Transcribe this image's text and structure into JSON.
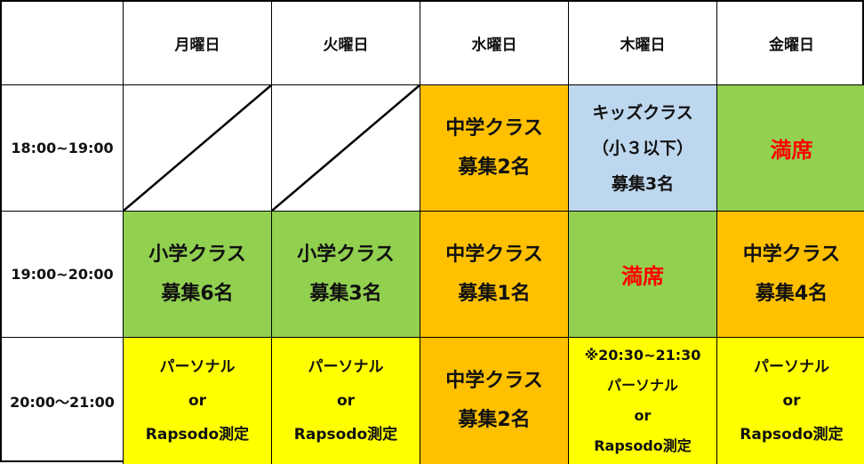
{
  "colors": {
    "orange": "#FFC000",
    "blue": "#BDD7EE",
    "green": "#92D050",
    "yellow": "#FFFF00",
    "full_text": "#FF0000"
  },
  "header": {
    "corner": "",
    "days": [
      "月曜日",
      "火曜日",
      "水曜日",
      "木曜日",
      "金曜日"
    ]
  },
  "rows": [
    {
      "time": "18:00~19:00",
      "cells": [
        {
          "type": "empty",
          "lines": []
        },
        {
          "type": "empty",
          "lines": []
        },
        {
          "type": "class",
          "color": "orange",
          "lines": [
            "中学クラス",
            "募集2名"
          ]
        },
        {
          "type": "class",
          "color": "blue",
          "lines": [
            "キッズクラス",
            "（小３以下）",
            "募集3名"
          ]
        },
        {
          "type": "full",
          "color": "green",
          "lines": [
            "満席"
          ]
        }
      ]
    },
    {
      "time": "19:00~20:00",
      "cells": [
        {
          "type": "class",
          "color": "green",
          "lines": [
            "小学クラス",
            "募集6名"
          ]
        },
        {
          "type": "class",
          "color": "green",
          "lines": [
            "小学クラス",
            "募集3名"
          ]
        },
        {
          "type": "class",
          "color": "orange",
          "lines": [
            "中学クラス",
            "募集1名"
          ]
        },
        {
          "type": "full",
          "color": "green",
          "lines": [
            "満席"
          ]
        },
        {
          "type": "class",
          "color": "orange",
          "lines": [
            "中学クラス",
            "募集4名"
          ]
        }
      ]
    },
    {
      "time": "20:00～21:00",
      "cells": [
        {
          "type": "personal",
          "color": "yellow",
          "lines": [
            "パーソナル",
            "or",
            "Rapsodo測定"
          ]
        },
        {
          "type": "personal",
          "color": "yellow",
          "lines": [
            "パーソナル",
            "or",
            "Rapsodo測定"
          ]
        },
        {
          "type": "class",
          "color": "orange",
          "lines": [
            "中学クラス",
            "募集2名"
          ]
        },
        {
          "type": "personal",
          "color": "yellow",
          "lines": [
            "※20:30~21:30",
            "パーソナル",
            "or",
            "Rapsodo測定"
          ]
        },
        {
          "type": "personal",
          "color": "yellow",
          "lines": [
            "パーソナル",
            "or",
            "Rapsodo測定"
          ]
        }
      ]
    }
  ]
}
